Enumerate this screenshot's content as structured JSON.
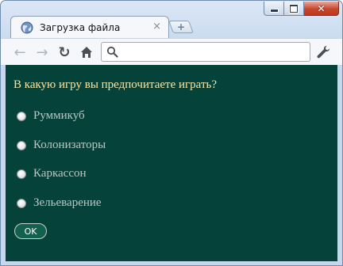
{
  "browser": {
    "tab_title": "Загрузка файла",
    "tab_close": "×",
    "new_tab": "+",
    "omnibox_value": ""
  },
  "icons": {
    "back": "arrow-left-icon",
    "forward": "arrow-right-icon",
    "reload": "reload-icon",
    "home": "home-icon",
    "search": "search-icon",
    "wrench": "wrench-icon",
    "tab_favicon": "globe-icon"
  },
  "colors": {
    "content_background": "#04423a",
    "question_text": "#f7e6a6",
    "option_text": "#b7c9c4",
    "button_background": "#13604f"
  },
  "form": {
    "question": "В какую игру вы предпочитаете играть?",
    "options": [
      "Руммикуб",
      "Колонизаторы",
      "Каркассон",
      "Зельеварение"
    ],
    "selected": null,
    "submit_label": "OK"
  }
}
